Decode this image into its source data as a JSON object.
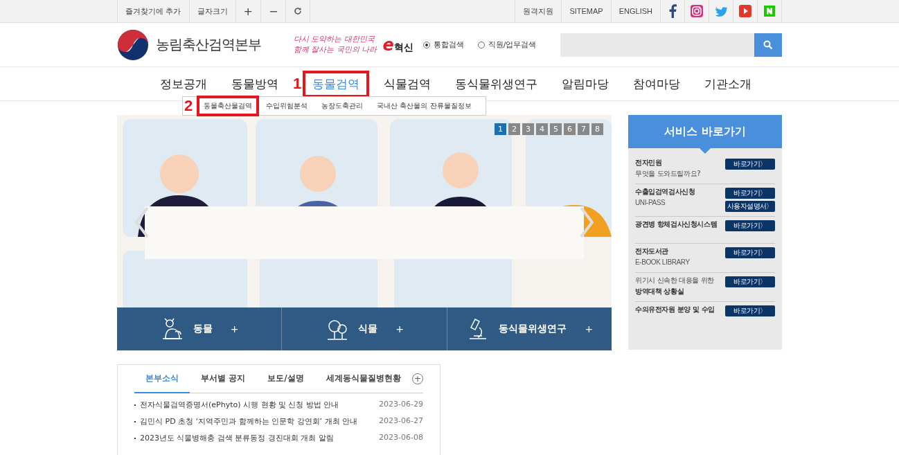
{
  "top_bar": {
    "left": [
      {
        "kind": "text",
        "label": "즐겨찾기에 추가"
      },
      {
        "kind": "text",
        "label": "글자크기"
      },
      {
        "kind": "text",
        "label": "+"
      },
      {
        "kind": "text",
        "label": "−"
      },
      {
        "kind": "refresh"
      }
    ],
    "links": [
      "원격지원",
      "SITEMAP",
      "ENGLISH"
    ],
    "social": [
      {
        "kind": "f"
      },
      {
        "kind": "camera"
      },
      {
        "kind": "bird"
      },
      {
        "kind": "play"
      },
      {
        "kind": "n"
      }
    ]
  },
  "header": {
    "logo": "농림축산검역본부",
    "slogan": [
      "다시 도약하는 대한민국",
      "함께 잘사는 국민의 나라"
    ],
    "badge": {
      "mark": "e",
      "text": "혁신"
    },
    "search_scope": [
      {
        "label": "통합검색",
        "selected": true
      },
      {
        "label": "직원/업무검색",
        "selected": false
      }
    ]
  },
  "nav": [
    {
      "label": "정보공개",
      "selected": false
    },
    {
      "label": "동물방역",
      "selected": false
    },
    {
      "label": "동물검역",
      "selected": true,
      "annotation": "1"
    },
    {
      "label": "식물검역",
      "selected": false
    },
    {
      "label": "동식물위생연구",
      "selected": false
    },
    {
      "label": "알림마당",
      "selected": false
    },
    {
      "label": "참여마당",
      "selected": false
    },
    {
      "label": "기관소개",
      "selected": false
    }
  ],
  "submenu": [
    {
      "label": "동물축산물검역",
      "annotation": "2"
    },
    {
      "label": "수입위험분석"
    },
    {
      "label": "농장도축관리"
    },
    {
      "label": "국내산 축산물의 잔류물질정보"
    }
  ],
  "banner": {
    "kind": "picture",
    "pager": [
      {
        "label": "1",
        "selected": true
      },
      {
        "label": "2",
        "selected": false
      },
      {
        "label": "3",
        "selected": false
      },
      {
        "label": "4",
        "selected": false
      },
      {
        "label": "5",
        "selected": false
      },
      {
        "label": "6",
        "selected": false
      },
      {
        "label": "7",
        "selected": false
      },
      {
        "label": "8",
        "selected": false
      }
    ],
    "quick_links": [
      {
        "kind": "animal",
        "label": "동물",
        "more": "+"
      },
      {
        "kind": "plant",
        "label": "식물",
        "more": "+"
      },
      {
        "kind": "lab",
        "label": "동식물위생연구",
        "more": "+"
      }
    ]
  },
  "services": {
    "title": "서비스 바로가기",
    "items": [
      {
        "lines": [
          {
            "kind": "title",
            "text": "전자민원"
          },
          {
            "kind": "sub",
            "text": "무엇을 도와드릴까요?"
          }
        ],
        "buttons": [
          "바로가기〉"
        ]
      },
      {
        "lines": [
          {
            "kind": "title",
            "text": "수출입검역검사신청"
          },
          {
            "kind": "caps",
            "text": "UNI-PASS"
          }
        ],
        "buttons": [
          "바로가기〉",
          "사용자설명서〉"
        ]
      },
      {
        "lines": [
          {
            "kind": "title",
            "text": "광견병 항체검사신청시스템"
          }
        ],
        "buttons": [
          "바로가기〉"
        ]
      },
      {
        "lines": [
          {
            "kind": "title",
            "text": "전자도서관"
          },
          {
            "kind": "caps",
            "text": "E-BOOK LIBRARY"
          }
        ],
        "buttons": [
          "바로가기〉"
        ]
      },
      {
        "lines": [
          {
            "kind": "sub",
            "text": "위기시 신속한 대응을 위한"
          },
          {
            "kind": "title",
            "text": "방역대책 상황실"
          }
        ],
        "buttons": [
          "바로가기〉"
        ]
      },
      {
        "lines": [
          {
            "kind": "title",
            "text": "수의유전자원 분양 및 수입"
          }
        ],
        "buttons": [
          "바로가기〉"
        ]
      }
    ]
  },
  "news": {
    "tabs": [
      {
        "label": "본부소식",
        "selected": true
      },
      {
        "label": "부서별 공지",
        "selected": false
      },
      {
        "label": "보도/설명",
        "selected": false
      },
      {
        "label": "세계동식물질병현황",
        "selected": false
      }
    ],
    "more": "+",
    "rows": [
      {
        "title": "전자식물검역증명서(ePhyto) 시행 현황 및 신청 방법 안내",
        "date": "2023-06-29"
      },
      {
        "title": "김민식 PD 초청 ‘지역주민과 함께하는 인문학 강연회’ 개최 안내",
        "date": "2023-06-27"
      },
      {
        "title": "2023년도 식물병해충 검색 분류동정 경진대회 개최 알림",
        "date": "2023-06-08"
      }
    ]
  }
}
